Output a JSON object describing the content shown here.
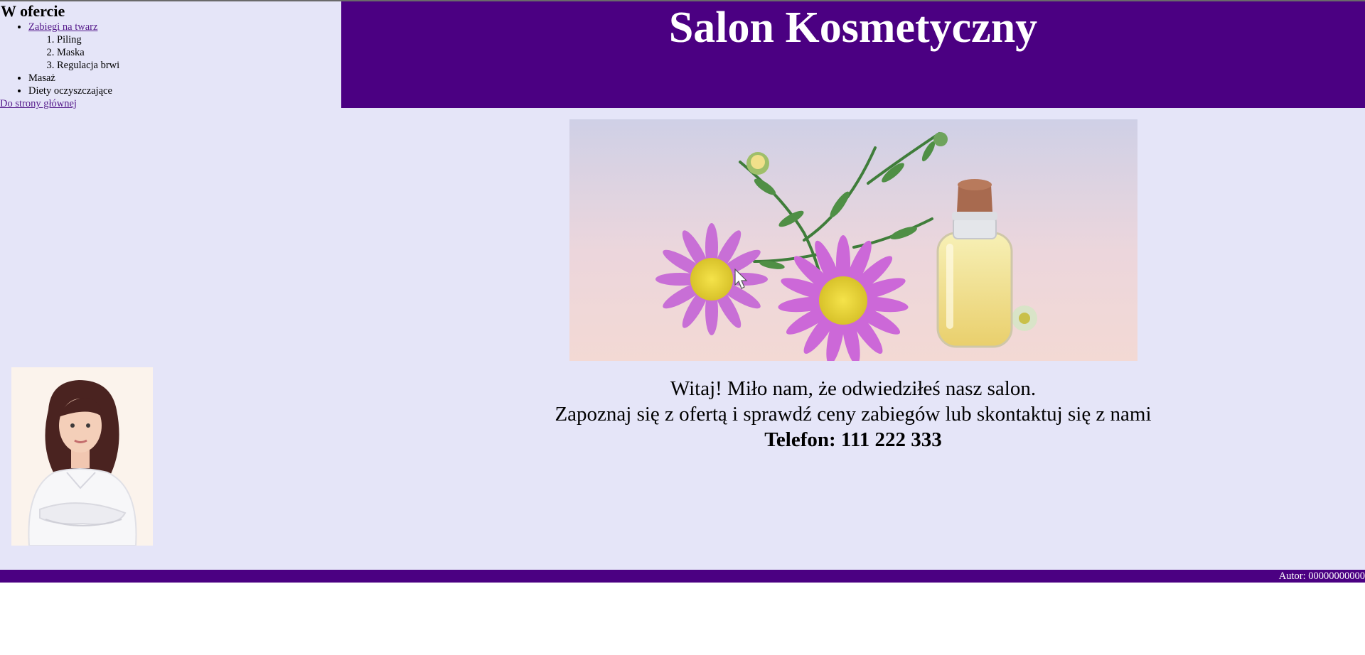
{
  "menu": {
    "heading": "W ofercie",
    "items": [
      {
        "label": "Zabiegi na twarz",
        "subitems": [
          "Piling",
          "Maska",
          "Regulacja brwi"
        ]
      },
      {
        "label": "Masaż"
      },
      {
        "label": "Diety oczyszczające"
      }
    ],
    "home_link": "Do strony głównej"
  },
  "banner": {
    "title": "Salon Kosmetyczny"
  },
  "welcome": {
    "line1": "Witaj! Miło nam, że odwiedziłeś nasz salon.",
    "line2": "Zapoznaj się z ofertą i sprawdź ceny zabiegów lub skontaktuj się z nami",
    "phone": "Telefon: 111 222 333"
  },
  "footer": {
    "author": "Autor: 00000000000"
  },
  "colors": {
    "accent": "#4b0082",
    "background": "#e5e5f8",
    "link": "#551a8b"
  }
}
